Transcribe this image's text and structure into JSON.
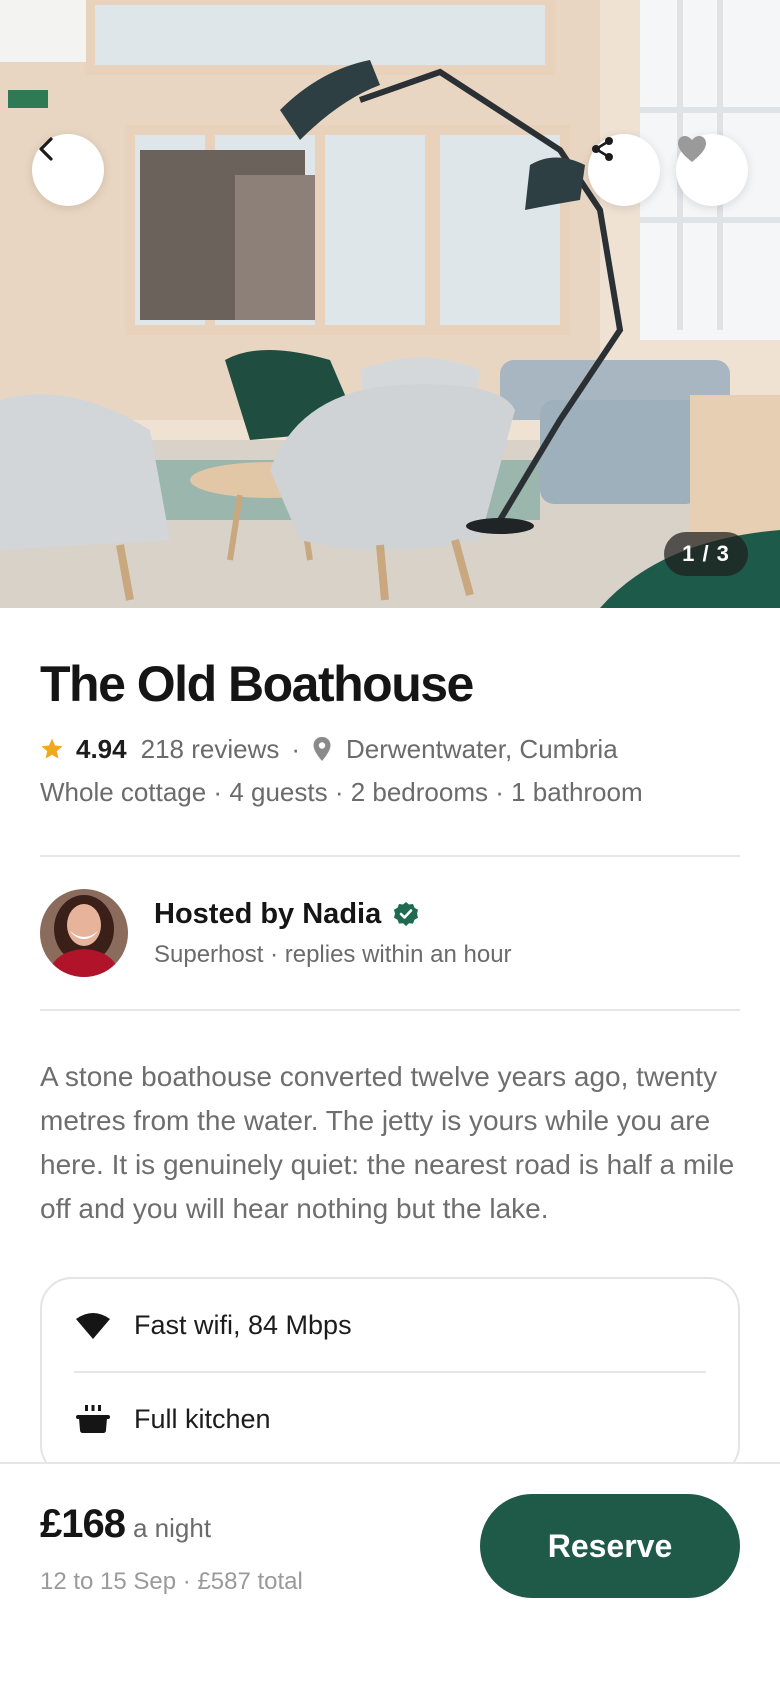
{
  "hero": {
    "photo_counter": "1 / 3",
    "icons": {
      "back": "chevron-left-icon",
      "share": "share-icon",
      "favorite": "heart-icon"
    }
  },
  "listing": {
    "title": "The Old Boathouse",
    "rating": "4.94",
    "reviews": "218 reviews",
    "separator": "·",
    "location": "Derwentwater, Cumbria",
    "details": "Whole cottage · 4 guests · 2 bedrooms · 1 bathroom",
    "description": "A stone boathouse converted twelve years ago, twenty metres from the water. The jetty is yours while you are here. It is genuinely quiet: the nearest road is half a mile off and you will hear nothing but the lake."
  },
  "host": {
    "name": "Hosted by Nadia",
    "subtitle": "Superhost · replies within an hour"
  },
  "amenities": [
    {
      "label": "Fast wifi, 84 Mbps",
      "icon": "wifi-icon"
    },
    {
      "label": "Full kitchen",
      "icon": "pot-icon"
    }
  ],
  "booking": {
    "price": "£168",
    "per": "a night",
    "dates": "12 to 15 Sep · £587 total",
    "reserve_label": "Reserve"
  },
  "colors": {
    "accent": "#1f5a48",
    "star": "#f2a81d",
    "verified": "#1f6b52"
  }
}
